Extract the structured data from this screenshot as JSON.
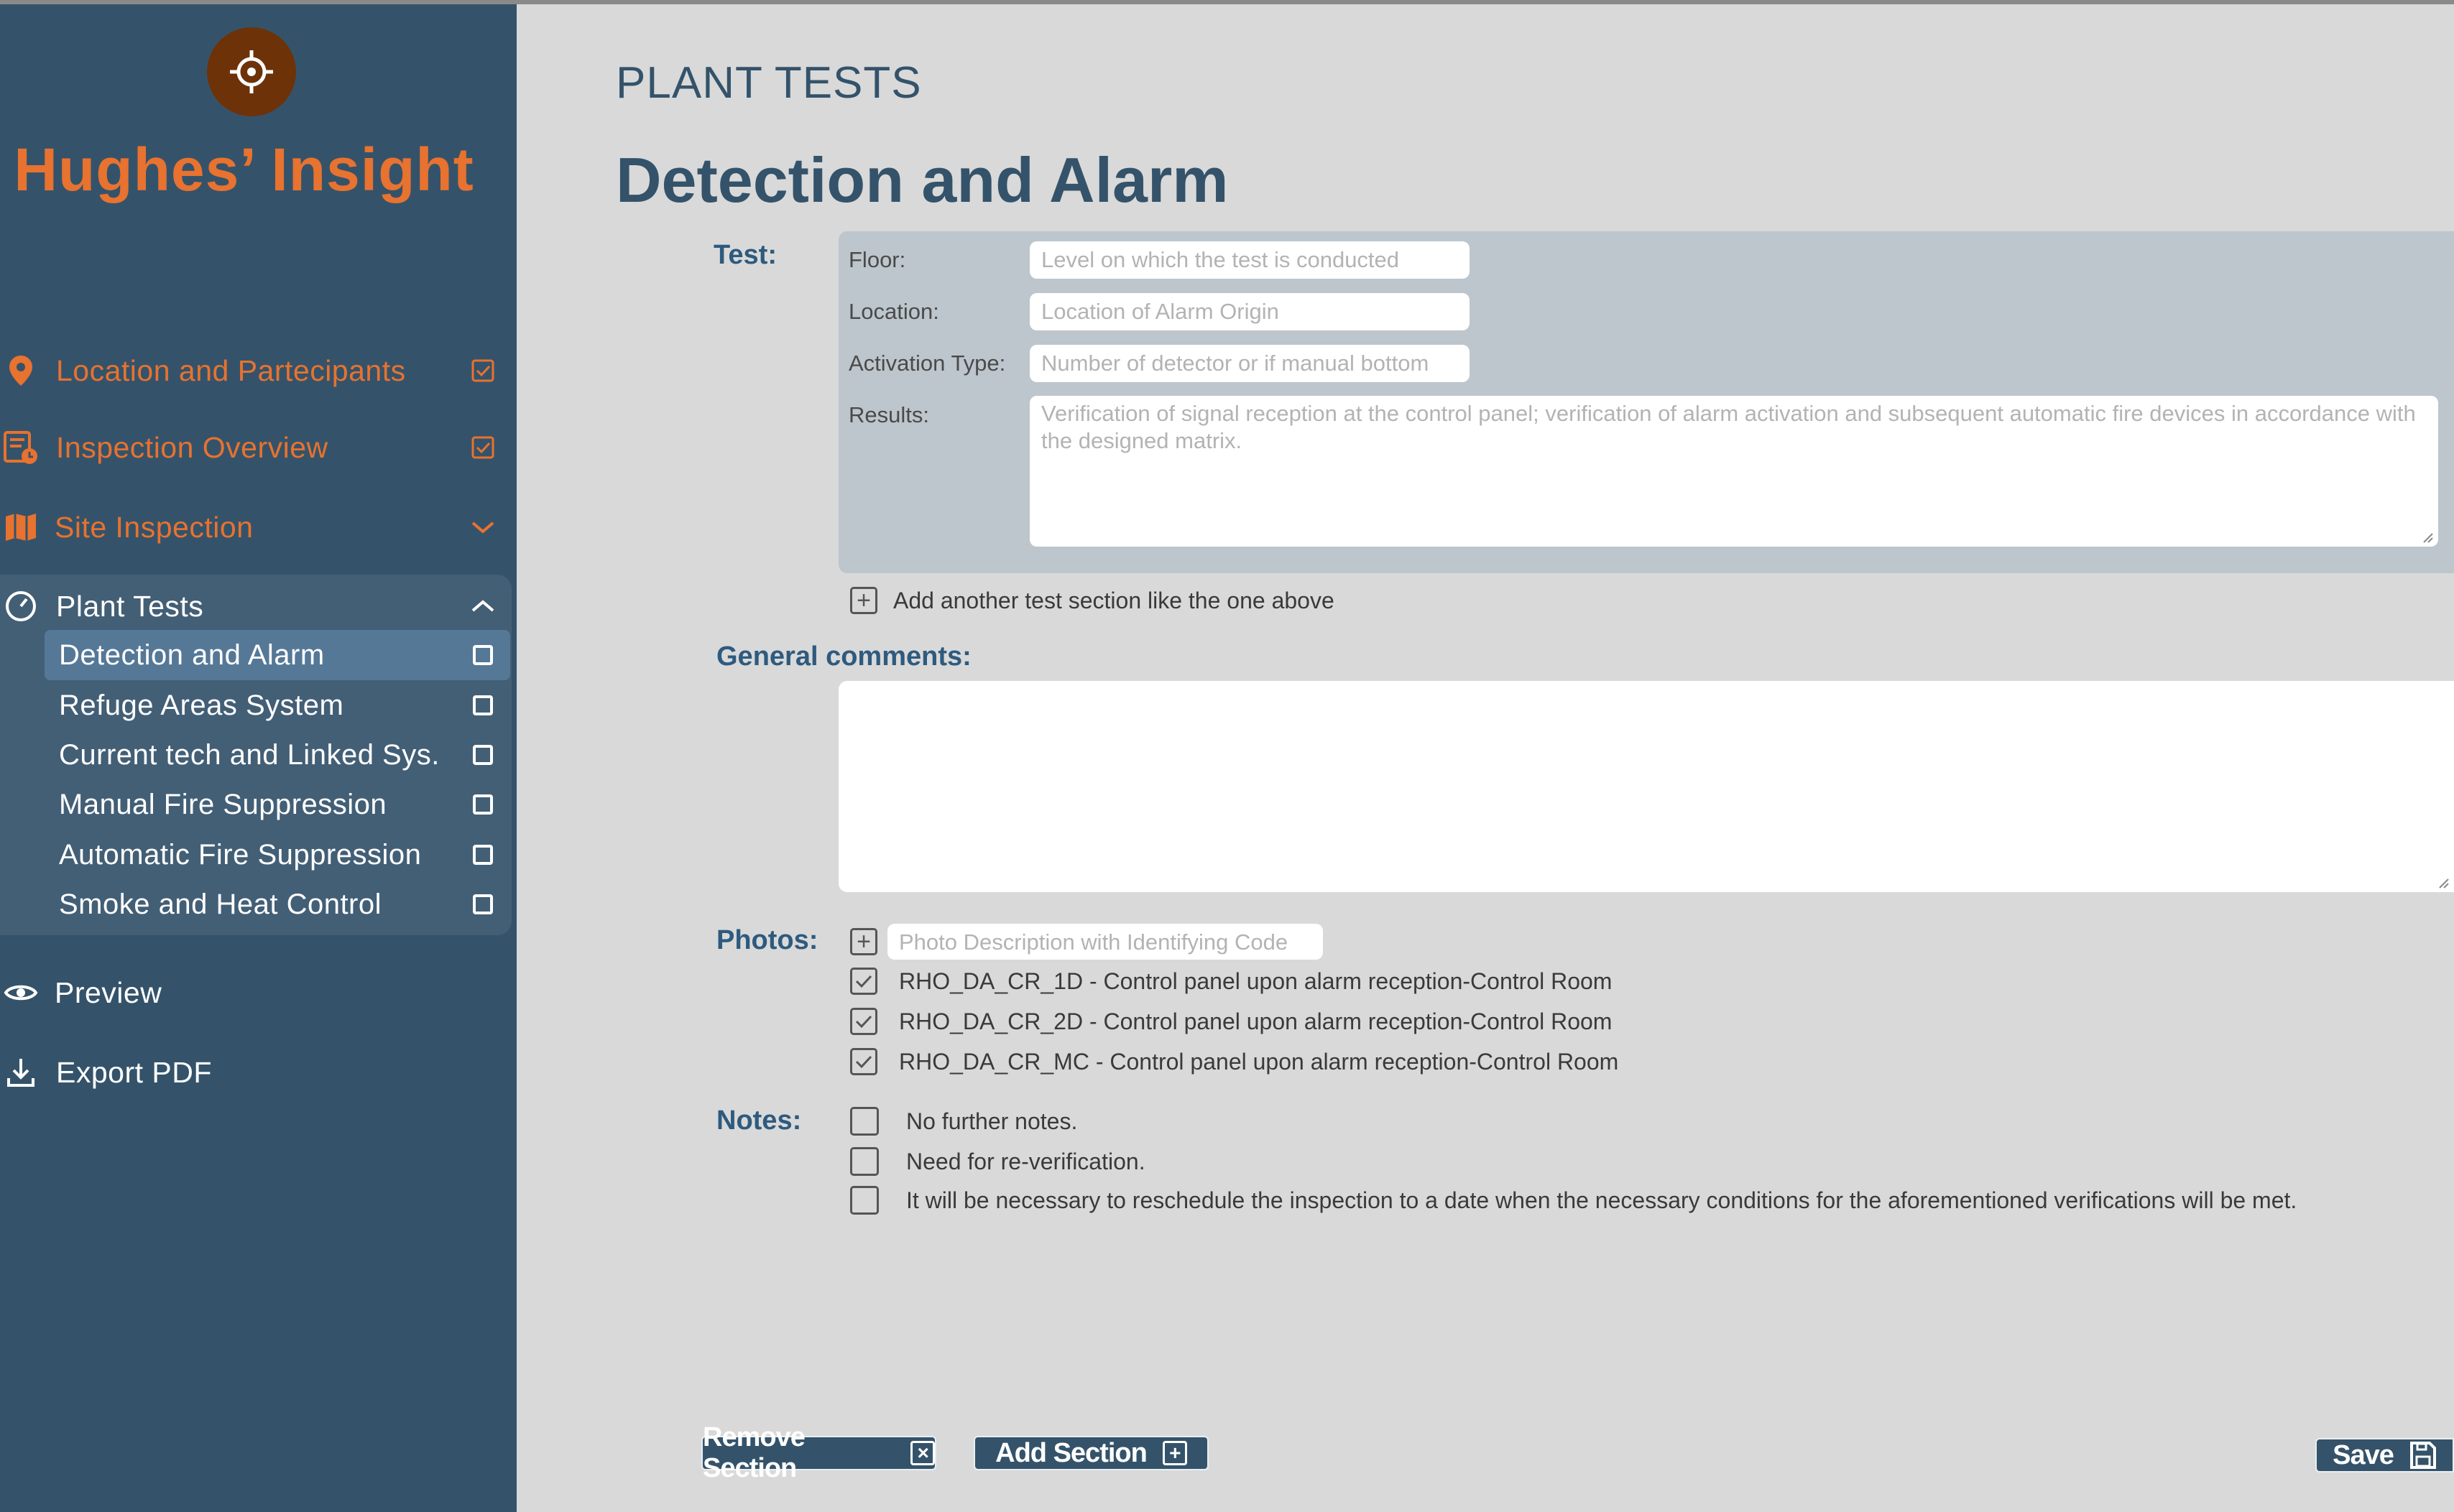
{
  "brand": {
    "name": "Hughes’ Insight",
    "logo_icon": "crosshair-icon"
  },
  "colors": {
    "sidebar": "#34536a",
    "accent": "#e8722f",
    "title": "#34536a",
    "panel": "#bdc6cc"
  },
  "sidebar": {
    "items": [
      {
        "label": "Location and Partecipants",
        "icon": "map-pin-icon",
        "status": "checked"
      },
      {
        "label": "Inspection Overview",
        "icon": "report-clock-icon",
        "status": "checked"
      },
      {
        "label": "Site Inspection",
        "icon": "map-book-icon",
        "status": "collapsed"
      },
      {
        "label": "Plant Tests",
        "icon": "gauge-icon",
        "status": "expanded"
      }
    ],
    "sub_items": [
      {
        "label": "Detection and Alarm",
        "active": true
      },
      {
        "label": "Refuge Areas System",
        "active": false
      },
      {
        "label": "Current tech and Linked Sys.",
        "active": false
      },
      {
        "label": "Manual Fire Suppression",
        "active": false
      },
      {
        "label": "Automatic Fire Suppression",
        "active": false
      },
      {
        "label": "Smoke and Heat Control",
        "active": false
      }
    ],
    "actions": [
      {
        "label": "Preview",
        "icon": "eye-icon"
      },
      {
        "label": "Export PDF",
        "icon": "download-icon"
      }
    ]
  },
  "main": {
    "section_title": "PLANT TESTS",
    "page_title": "Detection and Alarm",
    "test": {
      "label": "Test:",
      "floor_label": "Floor:",
      "floor_placeholder": "Level on which the test is conducted",
      "location_label": "Location:",
      "location_placeholder": "Location of Alarm Origin",
      "activation_label": "Activation Type:",
      "activation_placeholder": "Number of detector or if manual bottom",
      "results_label": "Results:",
      "results_placeholder": "Verification of signal reception at the control panel; verification of alarm activation and subsequent automatic fire devices in accordance with the designed matrix.",
      "add_another": "Add another test section like the one above"
    },
    "comments": {
      "label": "General comments:",
      "value": ""
    },
    "photos": {
      "label": "Photos:",
      "placeholder": "Photo Description with Identifying Code",
      "items": [
        {
          "label": "RHO_DA_CR_1D - Control panel upon alarm reception-Control Room",
          "checked": true
        },
        {
          "label": "RHO_DA_CR_2D - Control panel upon alarm reception-Control Room",
          "checked": true
        },
        {
          "label": "RHO_DA_CR_MC - Control panel upon alarm reception-Control Room",
          "checked": true
        }
      ]
    },
    "notes": {
      "label": "Notes:",
      "items": [
        {
          "label": "No further notes.",
          "checked": false
        },
        {
          "label": "Need for re-verification.",
          "checked": false
        },
        {
          "label": "It will be necessary to reschedule the inspection to a date when the necessary conditions for the aforementioned verifications will be met.",
          "checked": false
        }
      ]
    }
  },
  "footer": {
    "remove_label": "Remove Section",
    "add_label": "Add Section",
    "save_label": "Save"
  }
}
